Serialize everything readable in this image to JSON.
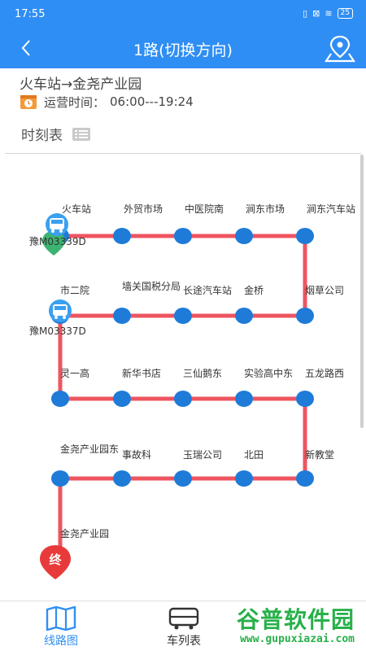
{
  "status_bar": {
    "time": "17:55",
    "battery": "25"
  },
  "header": {
    "title": "1路(切换方向)"
  },
  "route": {
    "text": "火车站→金尧产业园",
    "op_time_label": "运营时间：",
    "op_time_value": "06:00---19:24"
  },
  "schedule": {
    "label": "时刻表"
  },
  "stops": [
    "火车站",
    "外贸市场",
    "中医院南",
    "涧东市场",
    "涧东汽车站",
    "烟草公司",
    "金桥",
    "长途汽车站",
    "墙关国税分局",
    "市二院",
    "灵一高",
    "新华书店",
    "三仙鹅东",
    "实验高中东",
    "五龙路西",
    "新教堂",
    "北田",
    "玉瑞公司",
    "事故科",
    "金尧产业园东",
    "金尧产业园"
  ],
  "buses": [
    {
      "plate": "豫M03339D"
    },
    {
      "plate": "豫M03337D"
    }
  ],
  "end_marker": "终",
  "nav": {
    "tab1": "线路图",
    "tab2": "车列表"
  },
  "watermark": {
    "big": "谷普软件园",
    "small": "www.gupuxiazai.com"
  },
  "colors": {
    "primary": "#2f8ef4",
    "route_line": "#ee5560",
    "stop": "#1f7bd8",
    "end_marker": "#e83a3a",
    "watermark": "#28b04a"
  }
}
